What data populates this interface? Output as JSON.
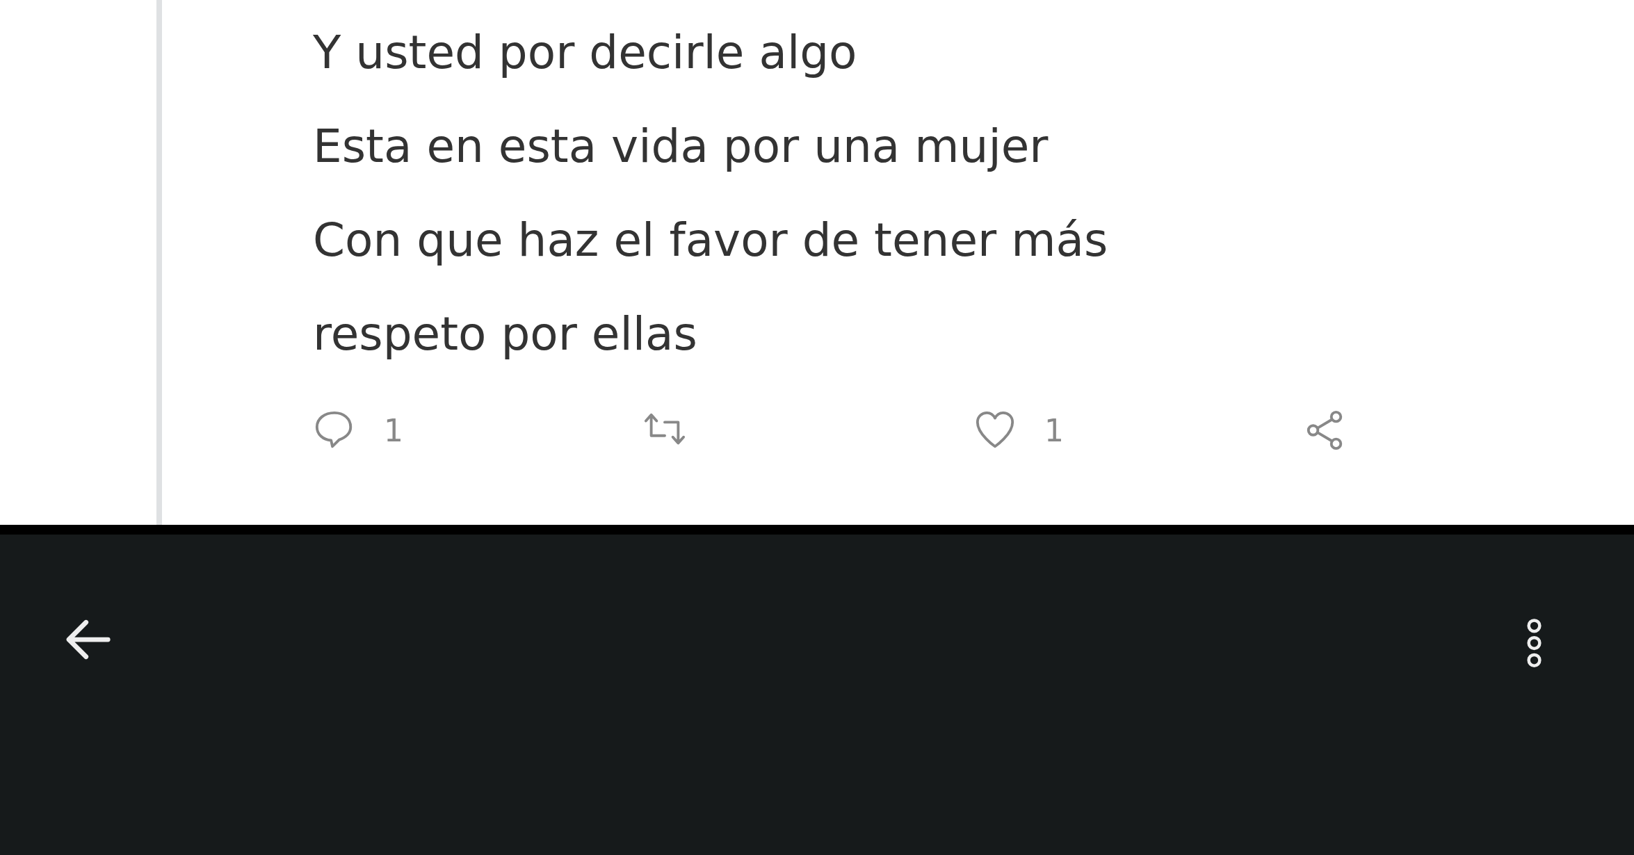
{
  "tweet": {
    "text": "Y usted por decirle algo\nEsta en esta vida por una mujer\nCon que haz el favor de tener más\nrespeto por ellas",
    "actions": [
      {
        "kind": "reply",
        "count": "1"
      },
      {
        "kind": "retweet"
      },
      {
        "kind": "like",
        "count": "1"
      },
      {
        "kind": "share"
      }
    ]
  }
}
